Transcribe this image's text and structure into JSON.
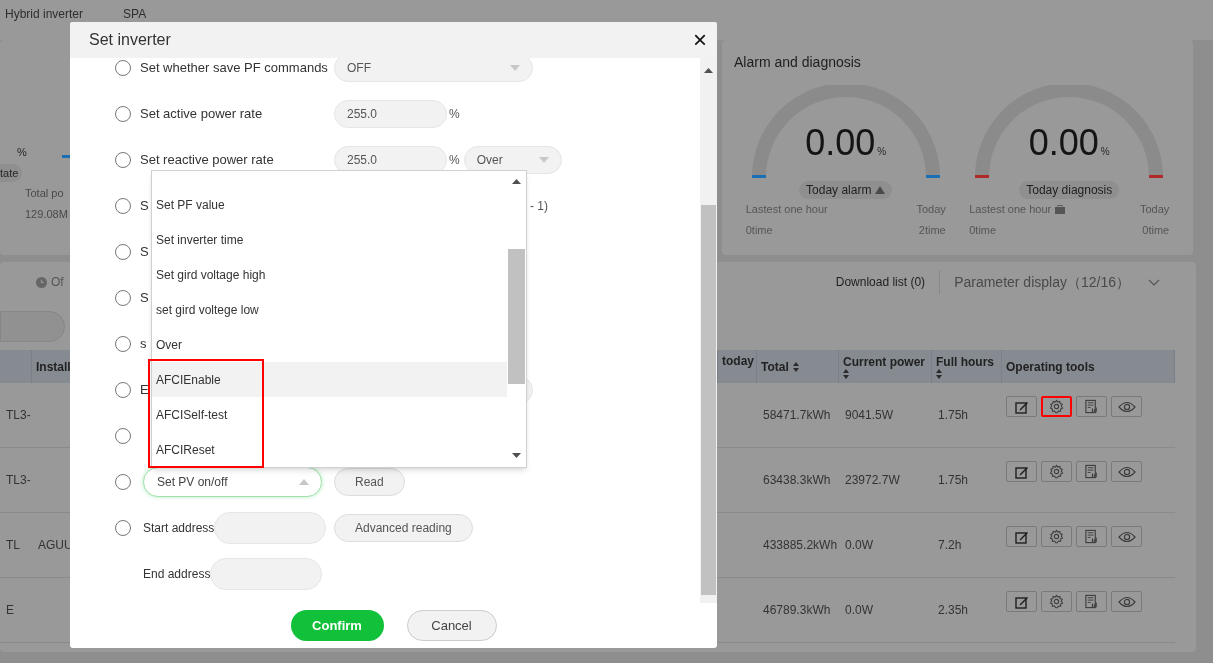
{
  "top_tabs": [
    "Hybrid inverter",
    "SPA"
  ],
  "overview": {
    "unit": "%",
    "state_label": "tate",
    "total_label": "Total po",
    "total_value": "129.08M"
  },
  "alarm_panel": {
    "title": "Alarm and diagnosis",
    "gauges": [
      {
        "kind": "alarm",
        "value": "0.00",
        "unit": "%",
        "label": "Today alarm",
        "color": "#1b6fb5",
        "left_label": "Lastest one hour",
        "left_value": "0time",
        "right_label": "Today",
        "right_value": "2time"
      },
      {
        "kind": "diagnosis",
        "value": "0.00",
        "unit": "%",
        "label": "Today diagnosis",
        "color": "#b02a2a",
        "left_label": "Lastest one hour",
        "left_value": "0time",
        "right_label": "Today",
        "right_value": "0time"
      }
    ]
  },
  "toolbar": {
    "status_filter": "Of",
    "download_list": "Download list (0)",
    "parameter_display": "Parameter display（12/16）"
  },
  "table": {
    "columns": [
      {
        "sortable": false
      },
      {
        "label": "Install",
        "sortable": false
      },
      {
        "label": "today",
        "sortable": false
      },
      {
        "label": "Total",
        "sortable": true
      },
      {
        "label": "Current power",
        "sortable": true
      },
      {
        "label": "Full hours",
        "sortable": true
      },
      {
        "label": "Operating tools",
        "sortable": false
      }
    ],
    "rows": [
      {
        "column_1": "TL3-",
        "total": "58471.7kWh",
        "current_power": "9041.5W",
        "full_hours": "1.75h",
        "tools": [
          {
            "kind": "edit",
            "annotated": false
          },
          {
            "kind": "settings",
            "annotated": true
          },
          {
            "kind": "report",
            "annotated": false
          },
          {
            "kind": "view",
            "annotated": false
          }
        ]
      },
      {
        "column_1": "TL3-",
        "total": "63438.3kWh",
        "current_power": "23972.7W",
        "full_hours": "1.75h",
        "tools": [
          {
            "kind": "edit",
            "annotated": false
          },
          {
            "kind": "settings",
            "annotated": false
          },
          {
            "kind": "report",
            "annotated": false
          },
          {
            "kind": "view",
            "annotated": false
          }
        ]
      },
      {
        "column_1": "TL",
        "install": "AGUU",
        "total": "433885.2kWh",
        "current_power": "0.0W",
        "full_hours": "7.2h",
        "tools": [
          {
            "kind": "edit",
            "annotated": false
          },
          {
            "kind": "settings",
            "annotated": false
          },
          {
            "kind": "report",
            "annotated": false
          },
          {
            "kind": "view",
            "annotated": false
          }
        ]
      },
      {
        "column_1": "E",
        "total": "46789.3kWh",
        "current_power": "0.0W",
        "full_hours": "2.35h",
        "tools": [
          {
            "kind": "edit",
            "annotated": false
          },
          {
            "kind": "settings",
            "annotated": false
          },
          {
            "kind": "report",
            "annotated": false
          },
          {
            "kind": "view",
            "annotated": false
          }
        ]
      }
    ]
  },
  "dialog": {
    "title": "Set inverter",
    "close": "×",
    "rows": [
      {
        "kind": "option",
        "selected": false,
        "label": "Set whether save PF commands",
        "controls": [
          {
            "kind": "select",
            "value": "OFF"
          }
        ]
      },
      {
        "kind": "option",
        "selected": false,
        "label": "Set active power rate",
        "controls": [
          {
            "kind": "number",
            "value": "255.0"
          },
          {
            "kind": "unit",
            "text": "%"
          }
        ]
      },
      {
        "kind": "option",
        "selected": false,
        "label": "Set reactive power rate",
        "controls": [
          {
            "kind": "number",
            "value": "255.0"
          },
          {
            "kind": "unit",
            "text": "%"
          },
          {
            "kind": "small_select",
            "value": "Over"
          }
        ]
      },
      {
        "kind": "option",
        "selected": false,
        "label": "S",
        "controls": [
          {
            "kind": "note",
            "text": "- 1)"
          }
        ]
      },
      {
        "kind": "option",
        "selected": false,
        "label": "S"
      },
      {
        "kind": "option",
        "selected": false,
        "label": "S"
      },
      {
        "kind": "option",
        "selected": false,
        "label": "s"
      },
      {
        "kind": "option",
        "selected": false,
        "label": "E",
        "controls": [
          {
            "kind": "select"
          }
        ]
      },
      {
        "kind": "option",
        "selected": false
      },
      {
        "kind": "option",
        "selected": false,
        "lead": {
          "kind": "open_select",
          "value": "Set PV on/off",
          "expanded": true
        },
        "controls": [
          {
            "kind": "button",
            "text": "Read"
          }
        ]
      },
      {
        "kind": "option",
        "selected": false,
        "lead": {
          "kind": "address",
          "label": "Start address"
        },
        "controls": [
          {
            "kind": "button",
            "text": "Advanced reading"
          }
        ]
      },
      {
        "kind": "sub",
        "lead": {
          "kind": "address",
          "label": "End address"
        }
      }
    ],
    "dropdown_options": [
      {
        "label": "Set PF value",
        "hovered": false,
        "annotated": false
      },
      {
        "label": "Set inverter time",
        "hovered": false,
        "annotated": false
      },
      {
        "label": "Set gird voltage high",
        "hovered": false,
        "annotated": false
      },
      {
        "label": "set gird voltege low",
        "hovered": false,
        "annotated": false
      },
      {
        "label": "Over",
        "hovered": false,
        "annotated": false
      },
      {
        "label": "AFCIEnable",
        "hovered": true,
        "annotated": true
      },
      {
        "label": "AFCISelf-test",
        "hovered": false,
        "annotated": true
      },
      {
        "label": "AFCIReset",
        "hovered": false,
        "annotated": true
      }
    ],
    "buttons": [
      {
        "kind": "primary",
        "text": "Confirm"
      },
      {
        "kind": "secondary",
        "text": "Cancel"
      }
    ]
  }
}
